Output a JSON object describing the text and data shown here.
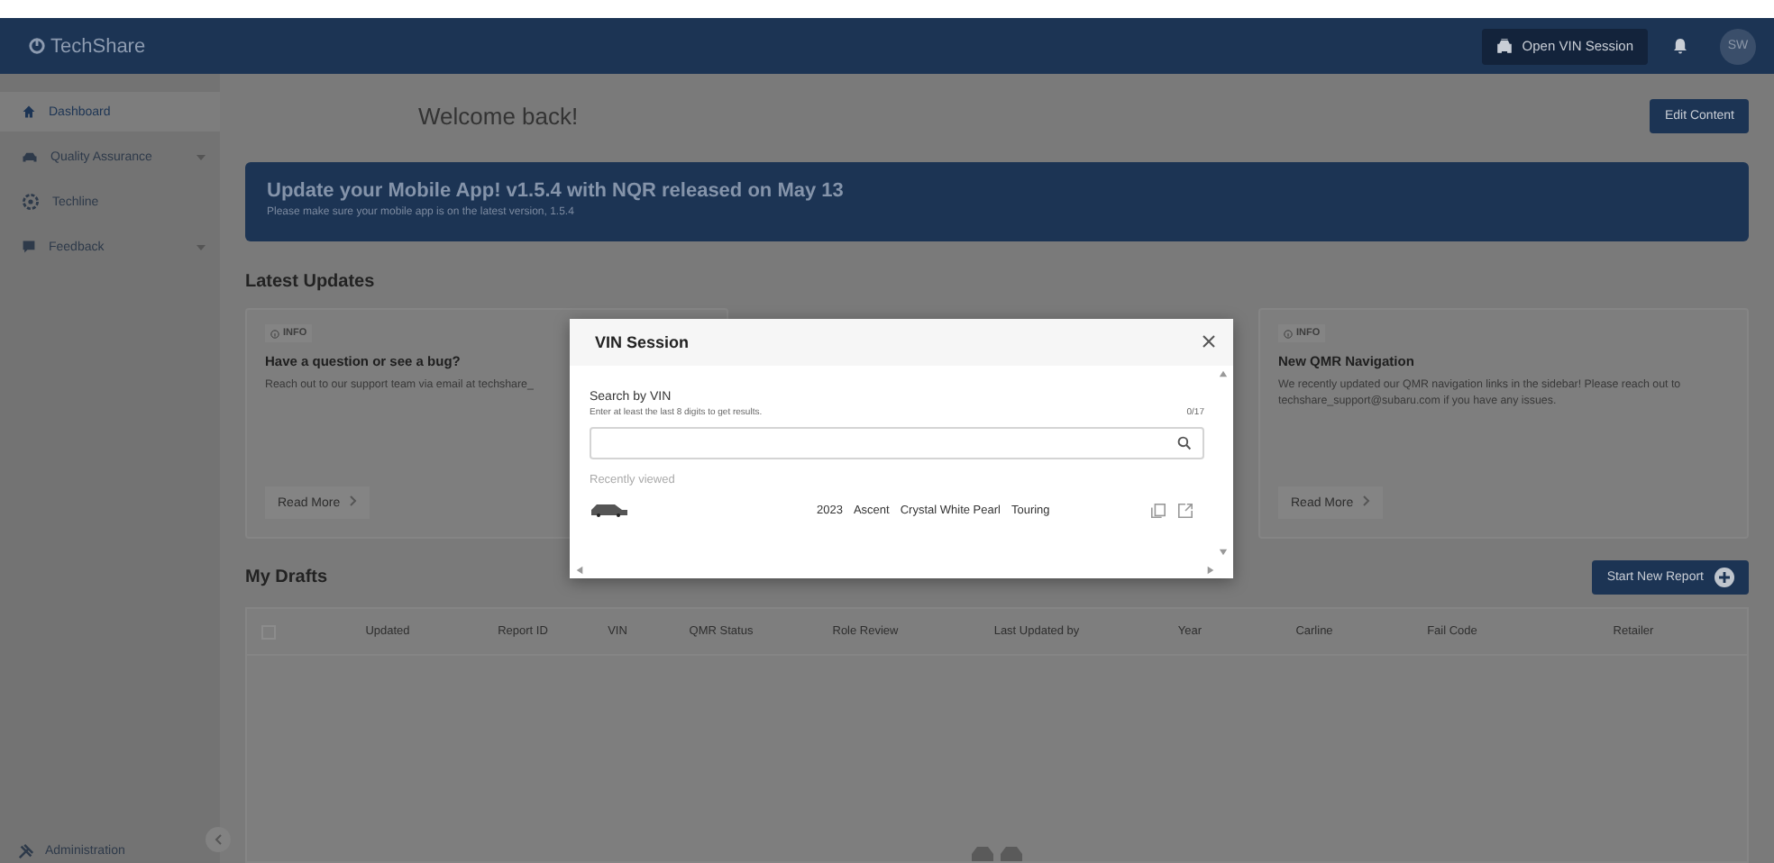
{
  "header": {
    "logo": "TechShare",
    "vin_button": "Open VIN Session",
    "avatar": "SW"
  },
  "sidebar": {
    "items": [
      {
        "label": "Dashboard",
        "selected": true,
        "expandable": false
      },
      {
        "label": "Quality Assurance",
        "selected": false,
        "expandable": true
      },
      {
        "label": "Techline",
        "selected": false,
        "expandable": false
      },
      {
        "label": "Feedback",
        "selected": false,
        "expandable": true
      }
    ],
    "footer": "Administration"
  },
  "welcome": "Welcome back!",
  "edit_button": "Edit Content",
  "banner": {
    "title": "Update your Mobile App! v1.5.4 with NQR released on May 13",
    "subtitle": "Please make sure your mobile app is on the latest version, 1.5.4"
  },
  "latest_updates": {
    "title": "Latest Updates",
    "cards": [
      {
        "badge": "INFO",
        "title": "Have a question or see a bug?",
        "text": "Reach out to our support team via email at techshare_",
        "button": "Read More"
      },
      {
        "badge": "INFO",
        "title": "New QMR Navigation",
        "text": "We recently updated our QMR navigation links in the sidebar! Please reach out to techshare_support@subaru.com if you have any issues.",
        "button": "Read More"
      }
    ]
  },
  "drafts": {
    "title": "My Drafts",
    "new_button": "Start New Report",
    "select_all_checked": false,
    "columns": [
      "Updated",
      "Report ID",
      "VIN",
      "QMR Status",
      "Role Review",
      "Last Updated by",
      "Year",
      "Carline",
      "Fail Code",
      "Retailer"
    ]
  },
  "modal": {
    "title": "VIN Session",
    "label": "Search by VIN",
    "hint": "Enter at least the last 8 digits to get results.",
    "counter": "0/17",
    "recent_title": "Recently viewed",
    "recent": [
      {
        "year": "2023",
        "model": "Ascent",
        "exterior": "Crystal White Pearl",
        "trim": "Touring"
      }
    ]
  }
}
